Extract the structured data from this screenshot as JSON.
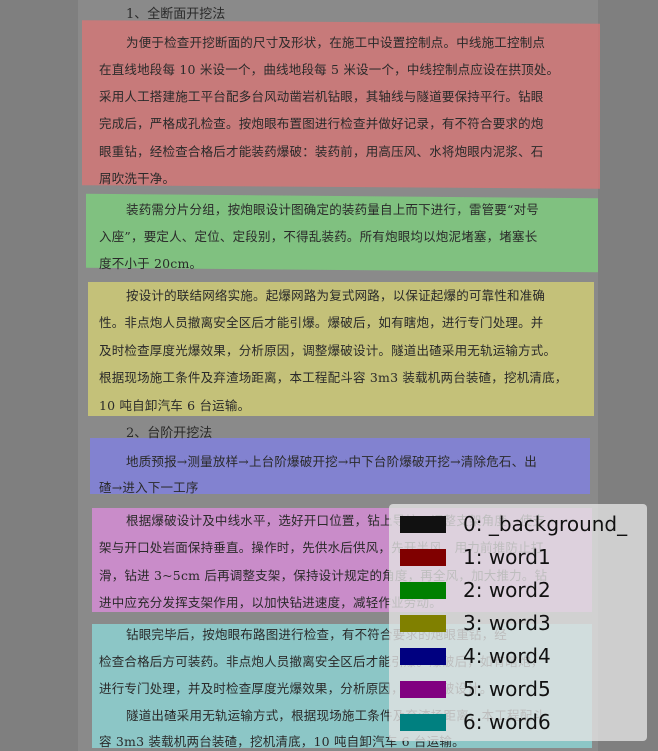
{
  "document": {
    "heading1": "1、全断面开挖法",
    "heading2": "2、台阶开挖法",
    "region1": [
      "为便于检查开挖断面的尺寸及形状，在施工中设置控制点。中线施工控制点",
      "在直线地段每 10 米设一个，曲线地段每 5 米设一个，中线控制点应设在拱顶处。",
      "采用人工搭建施工平台配多台风动凿岩机钻眼，其轴线与隧道要保持平行。钻眼",
      "完成后，严格成孔检查。按炮眼布置图进行检查并做好记录，有不符合要求的炮",
      "眼重钻，经检查合格后才能装药爆破：装药前，用高压风、水将炮眼内泥浆、石",
      "屑吹洗干净。"
    ],
    "region2": [
      "装药需分片分组，按炮眼设计图确定的装药量自上而下进行，雷管要“对号",
      "入座”，要定人、定位、定段别，不得乱装药。所有炮眼均以炮泥堵塞，堵塞长",
      "度不小于 20cm。"
    ],
    "region3": [
      "按设计的联结网络实施。起爆网路为复式网路，以保证起爆的可靠性和准确",
      "性。非点炮人员撤离安全区后才能引爆。爆破后，如有瞎炮，进行专门处理。并",
      "及时检查厚度光爆效果，分析原因，调整爆破设计。隧道出碴采用无轨运输方式。",
      "根据现场施工条件及弃渣场距离，本工程配斗容 3m3 装载机两台装碴，挖机清底，",
      "10 吨自卸汽车 6 台运输。"
    ],
    "region4": [
      "地质预报→测量放样→上台阶爆破开挖→中下台阶爆破开挖→清除危石、出",
      "碴→进入下一工序"
    ],
    "region5": [
      "根据爆破设计及中线水平，选好开口位置，钻上导坑，调整支架角度，使支",
      "架与开口处岩面保持垂直。操作时，先供水后供风，先开半风，用力前推防止打",
      "滑，钻进 3~5cm 后再调整支架，保持设计规定的角度，再全风，加大推力。钻",
      "进中应充分发挥支架作用，以加快钻进速度，减轻作业劳动。"
    ],
    "region6": [
      "钻眼完毕后，按炮眼布路图进行检查，有不符合要求的炮眼重钻，经",
      "检查合格后方可装药。非点炮人员撤离安全区后才能引爆。爆破后，如有瞎炮，",
      "进行专门处理，并及时检查厚度光爆效果，分析原因，调整爆破设计。",
      "隧道出碴采用无轨运输方式，根据现场施工条件及弃渣场距离，本工程配斗",
      "容 3m3 装载机两台装碴，挖机清底，10 吨自卸汽车 6 台运输。"
    ]
  },
  "legend": {
    "items": [
      {
        "label": "0: _background_",
        "color": "#111111"
      },
      {
        "label": "1: word1",
        "color": "#800000"
      },
      {
        "label": "2: word2",
        "color": "#008000"
      },
      {
        "label": "3: word3",
        "color": "#808000"
      },
      {
        "label": "4: word4",
        "color": "#000080"
      },
      {
        "label": "5: word5",
        "color": "#800080"
      },
      {
        "label": "6: word6",
        "color": "#008080"
      }
    ]
  }
}
